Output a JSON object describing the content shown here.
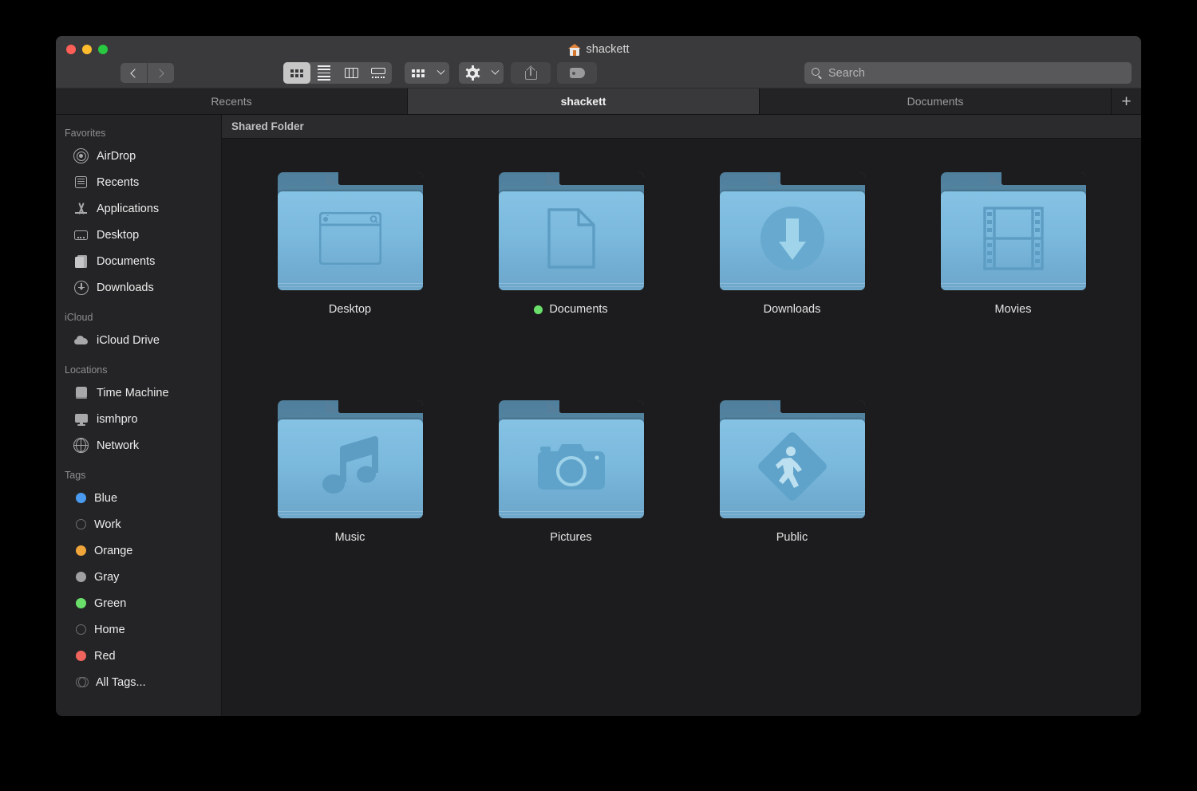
{
  "window": {
    "title": "shackett",
    "title_icon": "home-folder-icon",
    "traffic_lights": [
      {
        "name": "close",
        "color": "#ff5f57"
      },
      {
        "name": "minimize",
        "color": "#ffbd2e"
      },
      {
        "name": "maximize",
        "color": "#28c840"
      }
    ]
  },
  "toolbar": {
    "back_icon": "chevron-left-icon",
    "forward_icon": "chevron-right-icon",
    "view_icon_label": "icon-view-icon",
    "view_list_label": "list-view-icon",
    "view_column_label": "column-view-icon",
    "view_gallery_label": "gallery-view-icon",
    "group_by_icon": "group-by-icon",
    "action_icon": "gear-icon",
    "share_icon": "share-icon",
    "tags_icon": "tag-icon",
    "dropdown_caret": "chevron-down-icon"
  },
  "search": {
    "icon": "search-icon",
    "placeholder": "Search",
    "value": ""
  },
  "tabs": {
    "items": [
      {
        "label": "Recents",
        "active": false
      },
      {
        "label": "shackett",
        "active": true
      },
      {
        "label": "Documents",
        "active": false
      }
    ],
    "add_label": "+"
  },
  "sidebar": {
    "sections": [
      {
        "header": "Favorites",
        "items": [
          {
            "label": "AirDrop",
            "icon": "airdrop-icon"
          },
          {
            "label": "Recents",
            "icon": "recents-icon"
          },
          {
            "label": "Applications",
            "icon": "applications-icon"
          },
          {
            "label": "Desktop",
            "icon": "desktop-icon"
          },
          {
            "label": "Documents",
            "icon": "documents-icon"
          },
          {
            "label": "Downloads",
            "icon": "downloads-icon"
          }
        ]
      },
      {
        "header": "iCloud",
        "items": [
          {
            "label": "iCloud Drive",
            "icon": "icloud-drive-icon"
          }
        ]
      },
      {
        "header": "Locations",
        "items": [
          {
            "label": "Time Machine",
            "icon": "time-machine-icon"
          },
          {
            "label": "ismhpro",
            "icon": "computer-icon"
          },
          {
            "label": "Network",
            "icon": "network-icon"
          }
        ]
      },
      {
        "header": "Tags",
        "items": [
          {
            "label": "Blue",
            "icon": "tag-dot-icon",
            "color": "#4a9bf0"
          },
          {
            "label": "Work",
            "icon": "tag-dot-icon",
            "color": "none"
          },
          {
            "label": "Orange",
            "icon": "tag-dot-icon",
            "color": "#f0a53a"
          },
          {
            "label": "Gray",
            "icon": "tag-dot-icon",
            "color": "#a0a0a2"
          },
          {
            "label": "Green",
            "icon": "tag-dot-icon",
            "color": "#6ae06a"
          },
          {
            "label": "Home",
            "icon": "tag-dot-icon",
            "color": "none"
          },
          {
            "label": "Red",
            "icon": "tag-dot-icon",
            "color": "#f0645e"
          },
          {
            "label": "All Tags...",
            "icon": "all-tags-icon",
            "color": "none"
          }
        ]
      }
    ]
  },
  "content": {
    "shared_label": "Shared Folder",
    "items": [
      {
        "label": "Desktop",
        "glyph": "desktop-window-glyph",
        "tag_color": "none"
      },
      {
        "label": "Documents",
        "glyph": "document-page-glyph",
        "tag_color": "#6ae06a"
      },
      {
        "label": "Downloads",
        "glyph": "download-arrow-glyph",
        "tag_color": "none"
      },
      {
        "label": "Movies",
        "glyph": "film-strip-glyph",
        "tag_color": "none"
      },
      {
        "label": "Music",
        "glyph": "music-note-glyph",
        "tag_color": "none"
      },
      {
        "label": "Pictures",
        "glyph": "camera-glyph",
        "tag_color": "none"
      },
      {
        "label": "Public",
        "glyph": "pedestrian-sign-glyph",
        "tag_color": "none"
      }
    ]
  },
  "colors": {
    "folder_front": "#7bb9dd",
    "folder_back": "#567f9b",
    "window_bg": "#1c1c1e",
    "sidebar_bg": "#242426",
    "titlebar_bg": "#3a3a3c"
  }
}
